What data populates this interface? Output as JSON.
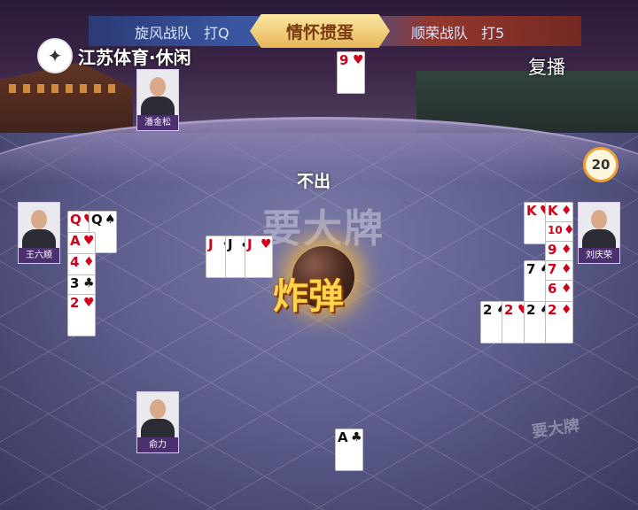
{
  "broadcast": {
    "logo_text": "江苏体育·休闲",
    "replay_label": "复播"
  },
  "header": {
    "left_team": "旋风战队",
    "left_level": "打Q",
    "title": "情怀掼蛋",
    "right_team": "顺荣战队",
    "right_level": "打5"
  },
  "center": {
    "pass_label": "不出",
    "watermark": "要大牌",
    "bomb_label": "炸弹"
  },
  "timer": {
    "value": "20"
  },
  "players": {
    "top": {
      "name": "潘金松"
    },
    "left": {
      "name": "王六顺"
    },
    "right": {
      "name": "刘庆荣"
    },
    "bottom": {
      "name": "俞力"
    }
  },
  "cards": {
    "top_played": [
      {
        "rank": "9",
        "suit": "♥",
        "color": "red"
      }
    ],
    "left_played": [
      {
        "rank": "Q",
        "suit": "♥",
        "color": "red"
      },
      {
        "rank": "Q",
        "suit": "♠",
        "color": "black"
      },
      {
        "rank": "A",
        "suit": "♥",
        "color": "red"
      },
      {
        "rank": "4",
        "suit": "♦",
        "color": "red"
      },
      {
        "rank": "3",
        "suit": "♣",
        "color": "black"
      },
      {
        "rank": "2",
        "suit": "♥",
        "color": "red"
      }
    ],
    "center_played": [
      {
        "rank": "J",
        "suit": "♦",
        "color": "red"
      },
      {
        "rank": "J",
        "suit": "♣",
        "color": "black"
      },
      {
        "rank": "J",
        "suit": "♥",
        "color": "red"
      }
    ],
    "right_played": [
      {
        "rank": "K",
        "suit": "♥",
        "color": "red"
      },
      {
        "rank": "K",
        "suit": "♦",
        "color": "red"
      },
      {
        "rank": "10",
        "suit": "♦",
        "color": "red"
      },
      {
        "rank": "9",
        "suit": "♦",
        "color": "red"
      },
      {
        "rank": "7",
        "suit": "♠",
        "color": "black"
      },
      {
        "rank": "7",
        "suit": "♦",
        "color": "red"
      },
      {
        "rank": "6",
        "suit": "♦",
        "color": "red"
      },
      {
        "rank": "2",
        "suit": "♠",
        "color": "black"
      },
      {
        "rank": "2",
        "suit": "♥",
        "color": "red"
      },
      {
        "rank": "2",
        "suit": "♠",
        "color": "black"
      },
      {
        "rank": "2",
        "suit": "♦",
        "color": "red"
      }
    ],
    "bottom_played": [
      {
        "rank": "A",
        "suit": "♣",
        "color": "black"
      }
    ]
  },
  "colors": {
    "card_red": "#d0021b",
    "card_black": "#111111",
    "header_gold": "#e7b85a"
  }
}
